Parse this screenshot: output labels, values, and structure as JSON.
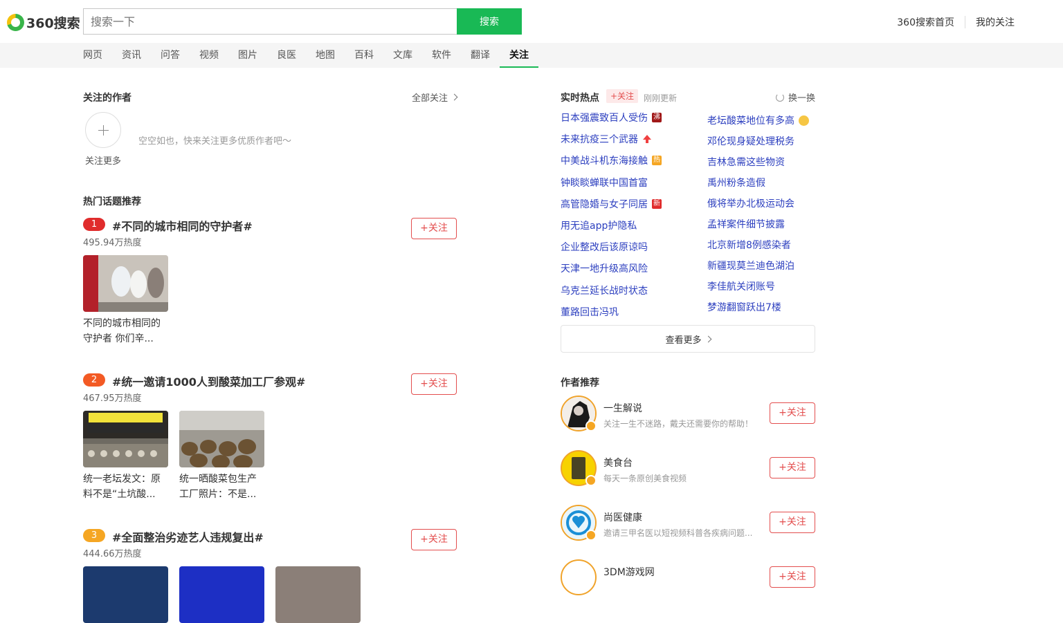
{
  "header": {
    "logo_text": "360搜索",
    "search_placeholder": "搜索一下",
    "search_button": "搜索",
    "links": [
      "360搜索首页",
      "我的关注"
    ]
  },
  "nav": {
    "items": [
      "网页",
      "资讯",
      "问答",
      "视频",
      "图片",
      "良医",
      "地图",
      "百科",
      "文库",
      "软件",
      "翻译"
    ],
    "active": "关注"
  },
  "authors_section": {
    "title": "关注的作者",
    "all_link": "全部关注",
    "add_label": "关注更多",
    "empty_text": "空空如也，快来关注更多优质作者吧～"
  },
  "topics_section": {
    "title": "热门话题推荐",
    "follow_label": "+关注",
    "topics": [
      {
        "rank": "1",
        "rank_color": "#e02c2c",
        "title": "#不同的城市相同的守护者#",
        "heat": "495.94万热度",
        "items": [
          {
            "caption": "不同的城市相同的守护者 你们辛..."
          }
        ]
      },
      {
        "rank": "2",
        "rank_color": "#f35a24",
        "title": "#统一邀请1000人到酸菜加工厂参观#",
        "heat": "467.95万热度",
        "items": [
          {
            "caption": "统一老坛发文：原料不是“土坑酸..."
          },
          {
            "caption": "统一晒酸菜包生产工厂照片：不是..."
          }
        ]
      },
      {
        "rank": "3",
        "rank_color": "#f5a623",
        "title": "#全面整治劣迹艺人违规复出#",
        "heat": "444.66万热度",
        "items": []
      }
    ]
  },
  "hot_section": {
    "title": "实时热点",
    "follow_tag": "+关注",
    "updated": "刚刚更新",
    "refresh": "换一换",
    "left": [
      {
        "text": "日本强震致百人受伤",
        "badge": "沸",
        "badge_color": "#a01818"
      },
      {
        "text": "未来抗疫三个武器",
        "badge": "up",
        "badge_color": "#f04040"
      },
      {
        "text": "中美战斗机东海接触",
        "badge": "热",
        "badge_color": "#f5a623"
      },
      {
        "text": "钟睒睒蝉联中国首富",
        "badge": "",
        "badge_color": ""
      },
      {
        "text": "高管隐婚与女子同居",
        "badge": "新",
        "badge_color": "#e02c2c"
      },
      {
        "text": "用无追app护隐私",
        "badge": "",
        "badge_color": ""
      },
      {
        "text": "企业整改后该原谅吗",
        "badge": "",
        "badge_color": ""
      },
      {
        "text": "天津一地升级高风险",
        "badge": "",
        "badge_color": ""
      },
      {
        "text": "乌克兰延长战时状态",
        "badge": "",
        "badge_color": ""
      },
      {
        "text": "董路回击冯巩",
        "badge": "",
        "badge_color": ""
      }
    ],
    "right": [
      {
        "text": "老坛酸菜地位有多高",
        "badge": "emoji"
      },
      {
        "text": "邓伦现身疑处理税务",
        "badge": ""
      },
      {
        "text": "吉林急需这些物资",
        "badge": ""
      },
      {
        "text": "禹州粉条造假",
        "badge": ""
      },
      {
        "text": "俄将举办北极运动会",
        "badge": ""
      },
      {
        "text": "孟祥案件细节披露",
        "badge": ""
      },
      {
        "text": "北京新增8例感染者",
        "badge": ""
      },
      {
        "text": "新疆现莫兰迪色湖泊",
        "badge": ""
      },
      {
        "text": "李佳航关闭账号",
        "badge": ""
      },
      {
        "text": "梦游翻窗跃出7楼",
        "badge": ""
      }
    ],
    "more": "查看更多"
  },
  "author_rec": {
    "title": "作者推荐",
    "follow_label": "+关注",
    "authors": [
      {
        "name": "一生解说",
        "desc": "关注一生不迷路，戴夫还需要你的帮助！"
      },
      {
        "name": "美食台",
        "desc": "每天一条原创美食视频"
      },
      {
        "name": "尚医健康",
        "desc": "邀请三甲名医以短视频科普各疾病问题..."
      },
      {
        "name": "3DM游戏网",
        "desc": ""
      }
    ]
  }
}
